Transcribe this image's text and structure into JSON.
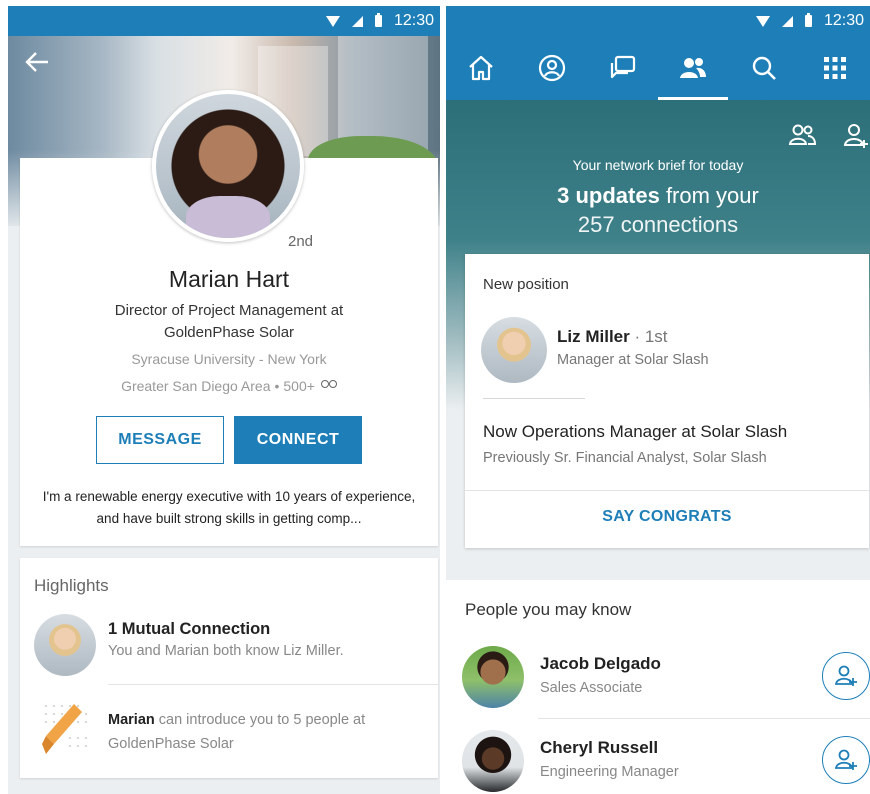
{
  "status_bar": {
    "time": "12:30"
  },
  "profile": {
    "name": "Marian Hart",
    "headline": "Director of Project Management at GoldenPhase Solar",
    "school": "Syracuse University - New York",
    "location": "Greater San Diego Area",
    "connections": "500+",
    "degree": "2nd",
    "message_label": "MESSAGE",
    "connect_label": "CONNECT",
    "summary": "I'm a renewable energy executive with 10 years of experience, and have built strong skills in getting comp..."
  },
  "highlights": {
    "title": "Highlights",
    "mutual_title": "1 Mutual Connection",
    "mutual_sub": "You and Marian both know Liz Miller.",
    "intro_name": "Marian",
    "intro_text": " can introduce you to 5 people at GoldenPhase Solar"
  },
  "network": {
    "brief_label": "Your network brief for today",
    "updates_bold": "3 updates",
    "updates_rest": " from your",
    "connections": "257 connections"
  },
  "update_card": {
    "label": "New position",
    "person_name": "Liz Miller",
    "person_degree": " · 1st",
    "person_title": "Manager at Solar Slash",
    "headline": "Now Operations Manager at Solar Slash",
    "sub": "Previously Sr. Financial Analyst, Solar Slash",
    "action": "SAY CONGRATS"
  },
  "pymk": {
    "title": "People you may know",
    "people": [
      {
        "name": "Jacob Delgado",
        "title": "Sales Associate"
      },
      {
        "name": "Cheryl Russell",
        "title": "Engineering Manager"
      }
    ]
  },
  "colors": {
    "brand_blue": "#1e7fb8",
    "hero_teal": "#2c6f79"
  },
  "icons": {
    "back": "arrow-left-icon",
    "nav": [
      "home-icon",
      "profile-icon",
      "messages-icon",
      "network-icon",
      "search-icon",
      "apps-grid-icon"
    ],
    "hero": [
      "manage-network-icon",
      "add-connection-icon"
    ]
  }
}
